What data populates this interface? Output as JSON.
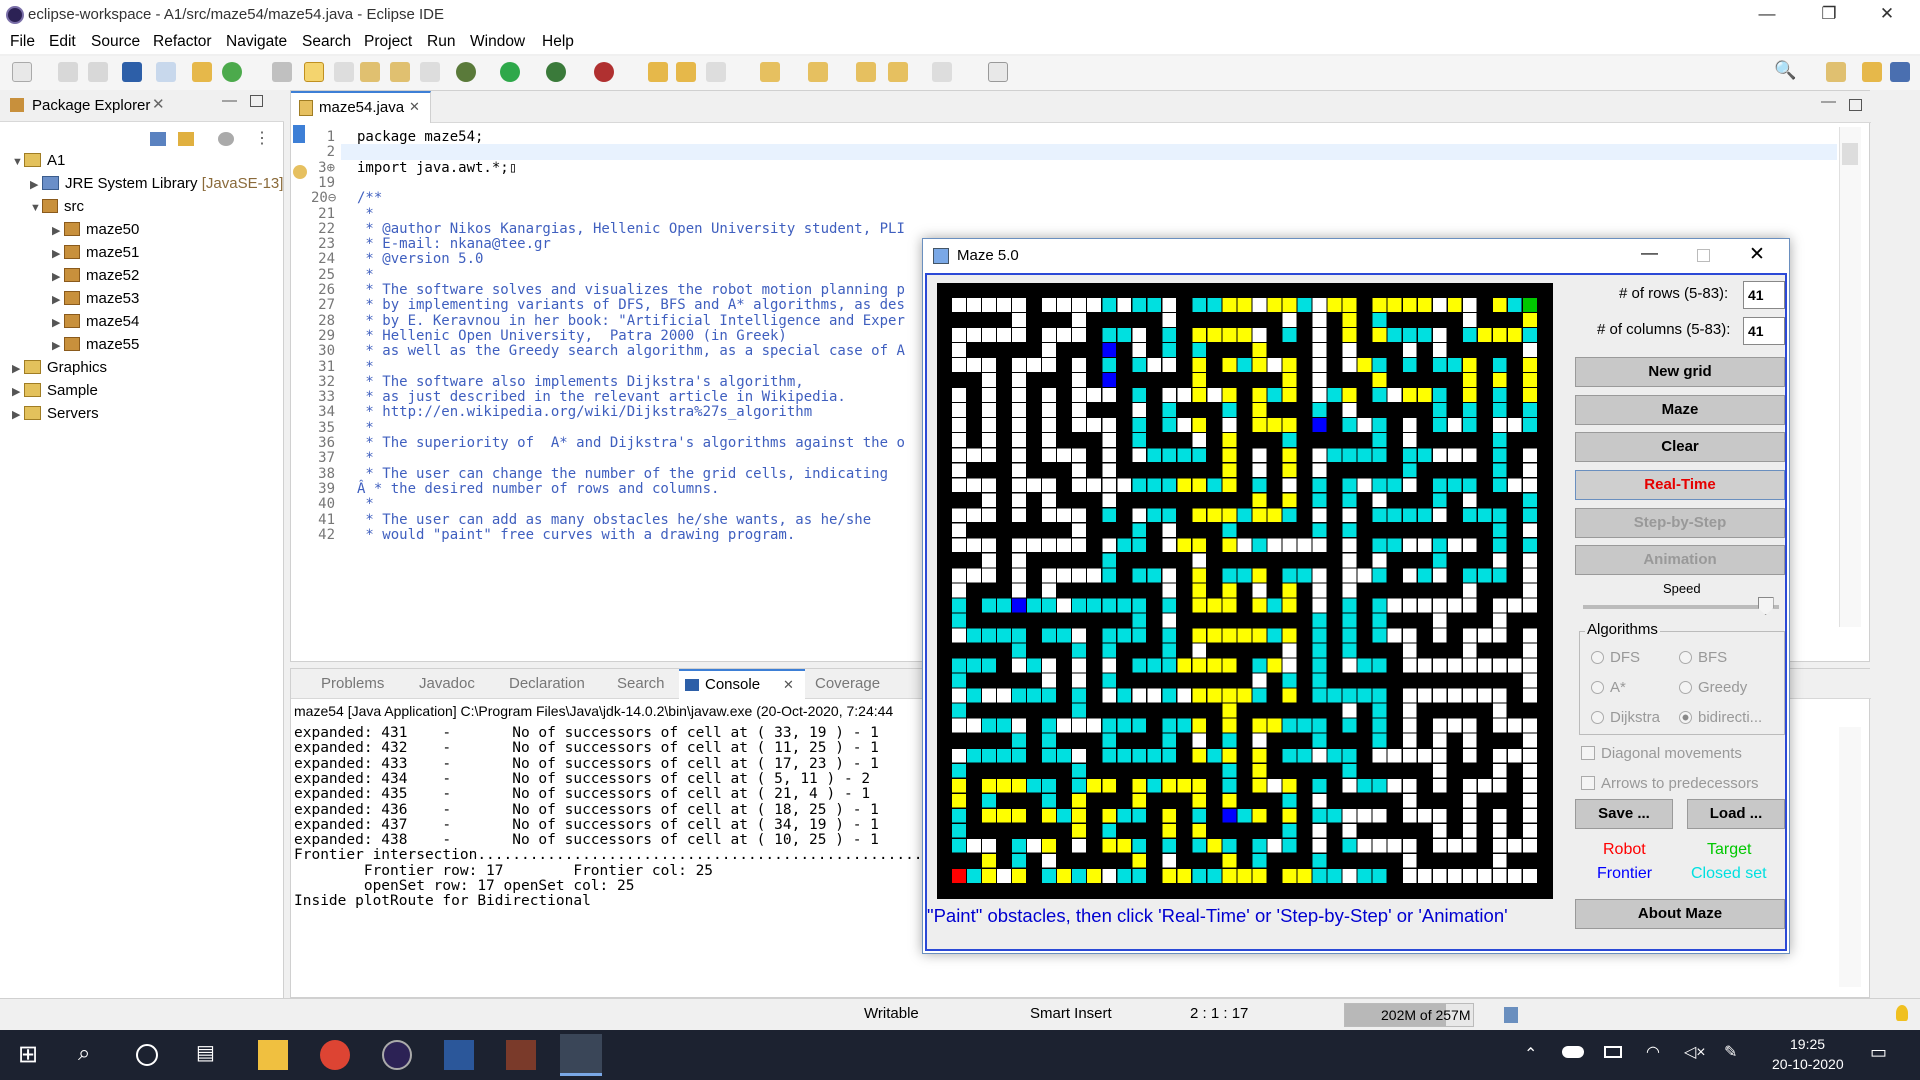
{
  "window": {
    "title": "eclipse-workspace - A1/src/maze54/maze54.java - Eclipse IDE",
    "controls": {
      "minimize": "—",
      "maximize": "❐",
      "close": "✕"
    }
  },
  "menu": [
    "File",
    "Edit",
    "Source",
    "Refactor",
    "Navigate",
    "Search",
    "Project",
    "Run",
    "Window",
    "Help"
  ],
  "package_explorer": {
    "title": "Package Explorer",
    "items": [
      {
        "label": "A1",
        "icon": "project-icon"
      },
      {
        "label": "JRE System Library",
        "suffix": "[JavaSE-13]",
        "icon": "library-icon"
      },
      {
        "label": "src",
        "icon": "source-folder-icon"
      },
      {
        "label": "maze50",
        "icon": "package-icon"
      },
      {
        "label": "maze51",
        "icon": "package-icon"
      },
      {
        "label": "maze52",
        "icon": "package-icon"
      },
      {
        "label": "maze53",
        "icon": "package-icon"
      },
      {
        "label": "maze54",
        "icon": "package-icon"
      },
      {
        "label": "maze55",
        "icon": "package-icon"
      },
      {
        "label": "Graphics",
        "icon": "project-icon"
      },
      {
        "label": "Sample",
        "icon": "project-icon"
      },
      {
        "label": "Servers",
        "icon": "project-icon"
      }
    ]
  },
  "editor": {
    "tab": "maze54.java",
    "lines": [
      {
        "n": "1",
        "t": "package maze54;",
        "kw": true
      },
      {
        "n": "2",
        "t": "",
        "kw": true
      },
      {
        "n": "3⊕",
        "t": "import java.awt.*;▯",
        "kw": true
      },
      {
        "n": "19",
        "t": "",
        "kw": true
      },
      {
        "n": "20⊖",
        "t": "/**",
        "kw": false
      },
      {
        "n": "21",
        "t": " *",
        "kw": false
      },
      {
        "n": "22",
        "t": " * @author Nikos Kanargias, Hellenic Open University student, PLI",
        "kw": false
      },
      {
        "n": "23",
        "t": " * E-mail: nkana@tee.gr",
        "kw": false
      },
      {
        "n": "24",
        "t": " * @version 5.0",
        "kw": false
      },
      {
        "n": "25",
        "t": " *",
        "kw": false
      },
      {
        "n": "26",
        "t": " * The software solves and visualizes the robot motion planning p",
        "kw": false
      },
      {
        "n": "27",
        "t": " * by implementing variants of DFS, BFS and A* algorithms, as des",
        "kw": false
      },
      {
        "n": "28",
        "t": " * by E. Keravnou in her book: \"Artificial Intelligence and Exper",
        "kw": false
      },
      {
        "n": "29",
        "t": " * Hellenic Open University,  Patra 2000 (in Greek)",
        "kw": false
      },
      {
        "n": "30",
        "t": " * as well as the Greedy search algorithm, as a special case of A",
        "kw": false
      },
      {
        "n": "31",
        "t": " *",
        "kw": false
      },
      {
        "n": "32",
        "t": " * The software also implements Dijkstra's algorithm,",
        "kw": false
      },
      {
        "n": "33",
        "t": " * as just described in the relevant article in Wikipedia.",
        "kw": false
      },
      {
        "n": "34",
        "t": " * http://en.wikipedia.org/wiki/Dijkstra%27s_algorithm",
        "kw": false
      },
      {
        "n": "35",
        "t": " *",
        "kw": false
      },
      {
        "n": "36",
        "t": " * The superiority of  A* and Dijkstra's algorithms against the o",
        "kw": false
      },
      {
        "n": "37",
        "t": " *",
        "kw": false
      },
      {
        "n": "38",
        "t": " * The user can change the number of the grid cells, indicating",
        "kw": false
      },
      {
        "n": "39",
        "t": "Â * the desired number of rows and columns.",
        "kw": false
      },
      {
        "n": "40",
        "t": " *",
        "kw": false
      },
      {
        "n": "41",
        "t": " * The user can add as many obstacles he/she wants, as he/she",
        "kw": false
      },
      {
        "n": "42",
        "t": " * would \"paint\" free curves with a drawing program.",
        "kw": false
      }
    ]
  },
  "console": {
    "tabs": [
      "Problems",
      "Javadoc",
      "Declaration",
      "Search",
      "Console",
      "Coverage"
    ],
    "active_tab": "Console",
    "header": "maze54 [Java Application] C:\\Program Files\\Java\\jdk-14.0.2\\bin\\javaw.exe (20-Oct-2020, 7:24:44",
    "lines": [
      "expanded: 431    -       No of successors of cell at ( 33, 19 ) - 1",
      "expanded: 432    -       No of successors of cell at ( 11, 25 ) - 1",
      "expanded: 433    -       No of successors of cell at ( 17, 23 ) - 1",
      "expanded: 434    -       No of successors of cell at ( 5, 11 ) - 2",
      "expanded: 435    -       No of successors of cell at ( 21, 4 ) - 1",
      "expanded: 436    -       No of successors of cell at ( 18, 25 ) - 1",
      "expanded: 437    -       No of successors of cell at ( 34, 19 ) - 1",
      "expanded: 438    -       No of successors of cell at ( 10, 25 ) - 1",
      "Frontier intersection.....................................................",
      "        Frontier row: 17        Frontier col: 25",
      "        openSet row: 17 openSet col: 25",
      "Inside plotRoute for Bidirectional"
    ]
  },
  "status": {
    "writable": "Writable",
    "insert": "Smart Insert",
    "position": "2 : 1 : 17",
    "heap": "202M of 257M",
    "heap_used_fraction": 0.79
  },
  "taskbar": {
    "time": "19:25",
    "date": "20-10-2020"
  },
  "maze": {
    "title": "Maze 5.0",
    "rows_label": "# of rows (5-83):",
    "rows_value": "41",
    "cols_label": "# of columns (5-83):",
    "cols_value": "41",
    "buttons": {
      "new_grid": "New grid",
      "maze": "Maze",
      "clear": "Clear",
      "real_time": "Real-Time",
      "step": "Step-by-Step",
      "animation": "Animation",
      "save": "Save ...",
      "load": "Load ...",
      "about": "About Maze"
    },
    "speed_label": "Speed",
    "speed_fraction": 0.97,
    "algorithms_label": "Algorithms",
    "algorithms": [
      "DFS",
      "BFS",
      "A*",
      "Greedy",
      "Dijkstra",
      "bidirecti..."
    ],
    "selected_algorithm": "bidirecti...",
    "diagonal_label": "Diagonal movements",
    "arrows_label": "Arrows to predecessors",
    "legend": {
      "robot": "Robot",
      "target": "Target",
      "frontier": "Frontier",
      "closed": "Closed set"
    },
    "colors": {
      "robot": "#ff0000",
      "target": "#00c800",
      "frontier": "#0000ff",
      "closed": "#00e0e0",
      "route": "#ffff00",
      "wall": "#000000",
      "free": "#ffffff",
      "real_time": "#ff0000"
    },
    "message": "\"Paint\" obstacles, then click 'Real-Time' or 'Step-by-Step' or 'Animation'"
  }
}
